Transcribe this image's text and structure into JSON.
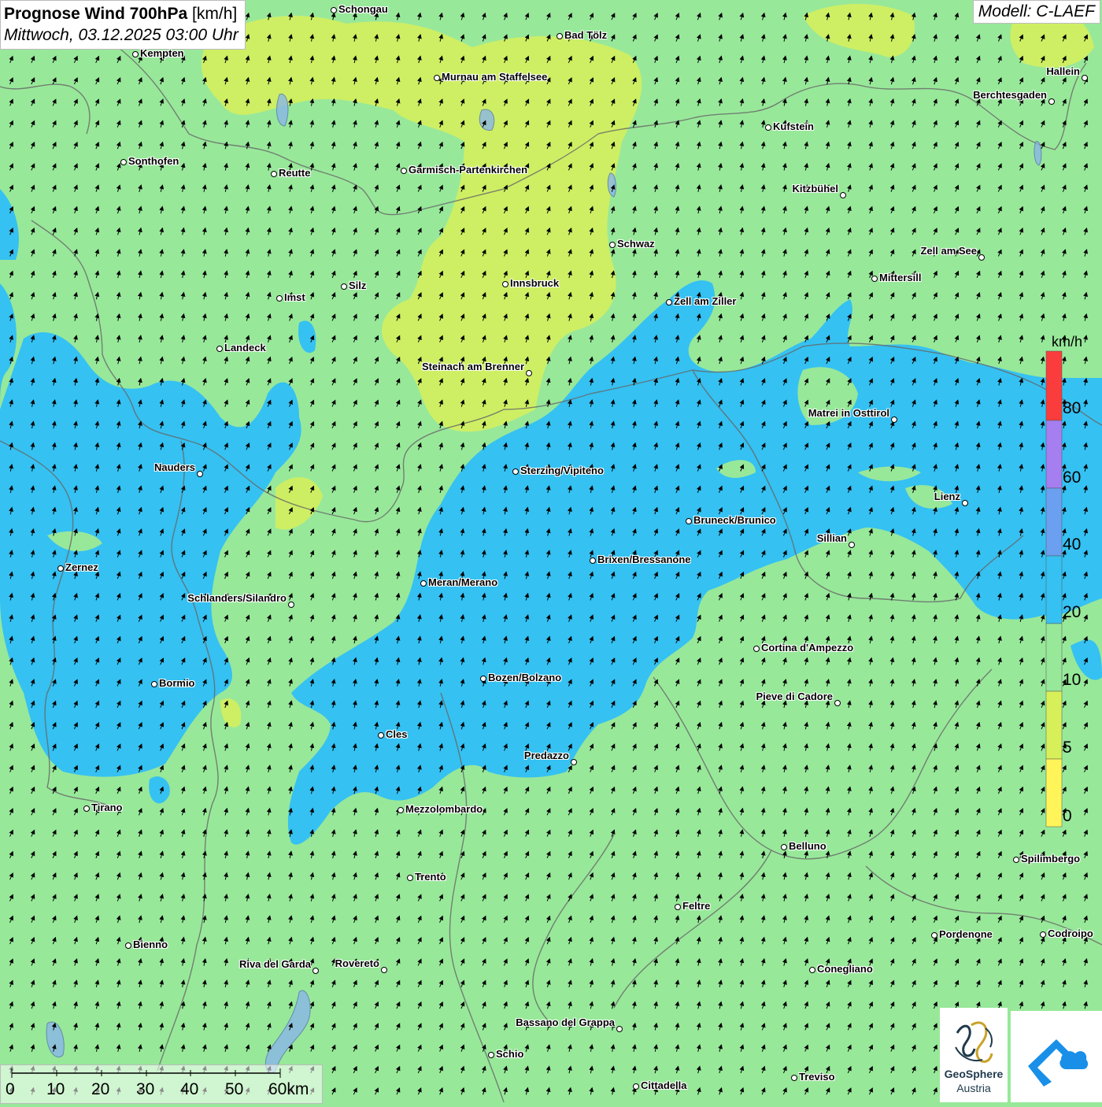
{
  "title": {
    "main": "Prognose Wind 700hPa",
    "unit": "[km/h]",
    "date": "Mittwoch, 03.12.2025 03:00 Uhr"
  },
  "model": "Modell: C-LAEF",
  "legend": {
    "unit": "km/h",
    "labels": [
      "80",
      "60",
      "40",
      "20",
      "10",
      "5",
      "0"
    ],
    "colors": [
      "#fb3c3c",
      "#a57ef0",
      "#6b9ff0",
      "#35c1f2",
      "#98e89a",
      "#d7f05a",
      "#fff559"
    ],
    "bands_top_to_bottom": [
      "80+",
      "60-80",
      "40-60",
      "20-40",
      "10-20",
      "5-10",
      "0-5"
    ]
  },
  "cities": [
    "Schongau",
    "Bad Tölz",
    "Kempten",
    "Murnau am Staffelsee",
    "Hallein",
    "Berchtesgaden",
    "Kufstein",
    "Sonthofen",
    "Reutte",
    "Garmisch-Partenkirchen",
    "Kitzbühel",
    "Schwaz",
    "Zell am See",
    "Mittersill",
    "Innsbruck",
    "Imst",
    "Silz",
    "Zell am Ziller",
    "Landeck",
    "Steinach am Brenner",
    "Matrei in Osttirol",
    "Nauders",
    "Sterzing/Vipiteno",
    "Lienz",
    "Bruneck/Brunico",
    "Sillian",
    "Zernez",
    "Brixen/Bressanone",
    "Meran/Merano",
    "Schlanders/Silandro",
    "Cortina d'Ampezzo",
    "Bormio",
    "Bozen/Bolzano",
    "Pieve di Cadore",
    "Cles",
    "Predazzo",
    "Tirano",
    "Mezzolombardo",
    "Belluno",
    "Spilimbergo",
    "Trento",
    "Feltre",
    "Pordenone",
    "Codroipo",
    "Bienno",
    "Riva del Garda",
    "Rovereto",
    "Conegliano",
    "Bassano del Grappa",
    "Schio",
    "Treviso",
    "Cittadella"
  ],
  "scalebar": {
    "labels": [
      "0",
      "10",
      "20",
      "30",
      "40",
      "50",
      "60km"
    ]
  },
  "logos": {
    "geosphere_line1": "GeoSphere",
    "geosphere_line2": "Austria"
  },
  "wind": {
    "prevailing_direction": "from south-southwest",
    "arrow_icon": "wind-arrow-icon"
  }
}
